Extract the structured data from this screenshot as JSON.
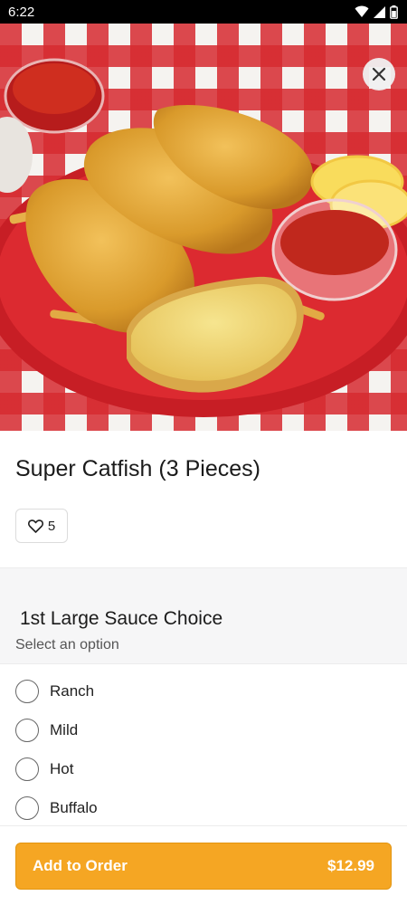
{
  "status_bar": {
    "time": "6:22",
    "icons": [
      "wifi-icon",
      "cell-signal-icon",
      "battery-icon"
    ]
  },
  "hero": {
    "close_icon": "close-icon"
  },
  "item": {
    "title": "Super Catfish (3 Pieces)",
    "likes": "5",
    "like_icon": "heart-outline-icon"
  },
  "sauce_section": {
    "title": "1st Large Sauce Choice",
    "subtitle": "Select an option",
    "options": [
      {
        "label": "Ranch"
      },
      {
        "label": "Mild"
      },
      {
        "label": "Hot"
      },
      {
        "label": "Buffalo"
      }
    ]
  },
  "cta": {
    "label": "Add to Order",
    "price": "$12.99"
  },
  "colors": {
    "accent": "#f5a623",
    "tablecloth_red": "#d62a30",
    "plate_red": "#d8252b"
  }
}
